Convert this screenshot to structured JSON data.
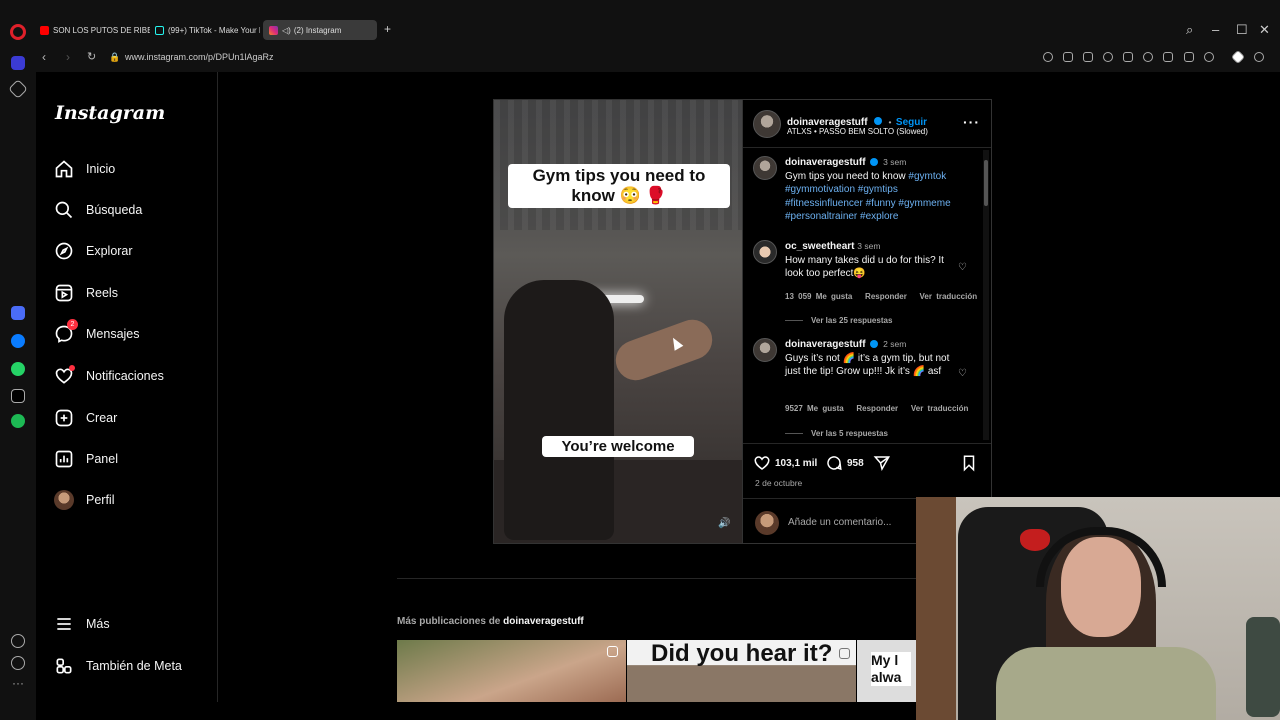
{
  "browser": {
    "tabs": [
      {
        "label": "SON LOS PUTOS DE RIBEI"
      },
      {
        "label": "(99+) TikTok - Make Your D"
      },
      {
        "label": "(2) Instagram"
      }
    ],
    "url": "www.instagram.com/p/DPUn1lAgaRz"
  },
  "sidebar": {
    "logo": "Instagram",
    "items": [
      {
        "label": "Inicio"
      },
      {
        "label": "Búsqueda"
      },
      {
        "label": "Explorar"
      },
      {
        "label": "Reels"
      },
      {
        "label": "Mensajes",
        "badge": "2"
      },
      {
        "label": "Notificaciones"
      },
      {
        "label": "Crear"
      },
      {
        "label": "Panel"
      },
      {
        "label": "Perfil"
      }
    ],
    "bottom": [
      {
        "label": "Más"
      },
      {
        "label": "También de Meta"
      }
    ]
  },
  "post": {
    "media": {
      "caption_top": "Gym tips you need to know 😳 🥊",
      "caption_bottom": "You’re welcome"
    },
    "author": "doinaveragestuff",
    "follow_label": "Seguir",
    "song": "ATLXS • PASSO BEM SOLTO (Slowed)",
    "caption": {
      "author": "doinaveragestuff",
      "time": "3 sem",
      "text": "Gym tips you need to know",
      "hashtags": "#gymtok #gymmotivation #gymtips #fitnessinfluencer #funny #gymmeme #personaltrainer #explore"
    },
    "comments": [
      {
        "author": "oc_sweetheart",
        "time": "3 sem",
        "text": "How many takes did u do for this? It look too perfect😝",
        "likes": "13 059 Me gusta",
        "reply": "Responder",
        "translate": "Ver traducción",
        "replies": "Ver las 25 respuestas"
      },
      {
        "author": "doinaveragestuff",
        "time": "2 sem",
        "text": "Guys it’s not 🌈 it’s a gym tip, but not just the tip! Grow up!!! Jk it’s 🌈 asf",
        "likes": "9527 Me gusta",
        "reply": "Responder",
        "translate": "Ver traducción",
        "replies": "Ver las 5 respuestas"
      }
    ],
    "likes": "103,1 mil",
    "comments_count": "958",
    "date": "2 de octubre",
    "comment_placeholder": "Añade un comentario..."
  },
  "more_posts": {
    "prefix": "Más publicaciones de",
    "author": "doinaveragestuff",
    "thumb2_text": "Did you hear it?",
    "thumb3_text": "My l alwa"
  }
}
